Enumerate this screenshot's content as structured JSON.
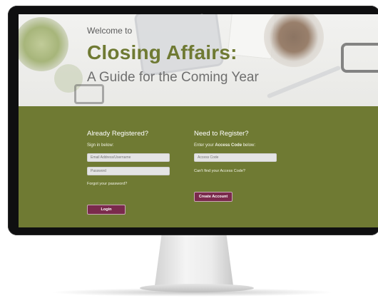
{
  "hero": {
    "welcome": "Welcome to",
    "title": "Closing Affairs:",
    "subtitle": "A Guide for the Coming Year"
  },
  "login": {
    "heading": "Already Registered?",
    "sub": "Sign in below:",
    "email_placeholder": "Email Address/Username",
    "password_placeholder": "Password",
    "forgot": "Forgot your password?",
    "button": "Login"
  },
  "register": {
    "heading": "Need to Register?",
    "sub_prefix": "Enter your ",
    "sub_bold": "Access Code",
    "sub_suffix": " below:",
    "code_placeholder": "Access Code",
    "cant_find": "Can't find your Access Code?",
    "button": "Create Account"
  },
  "colors": {
    "brand_olive": "#6f7a33",
    "button_maroon": "#7a2a4c"
  }
}
